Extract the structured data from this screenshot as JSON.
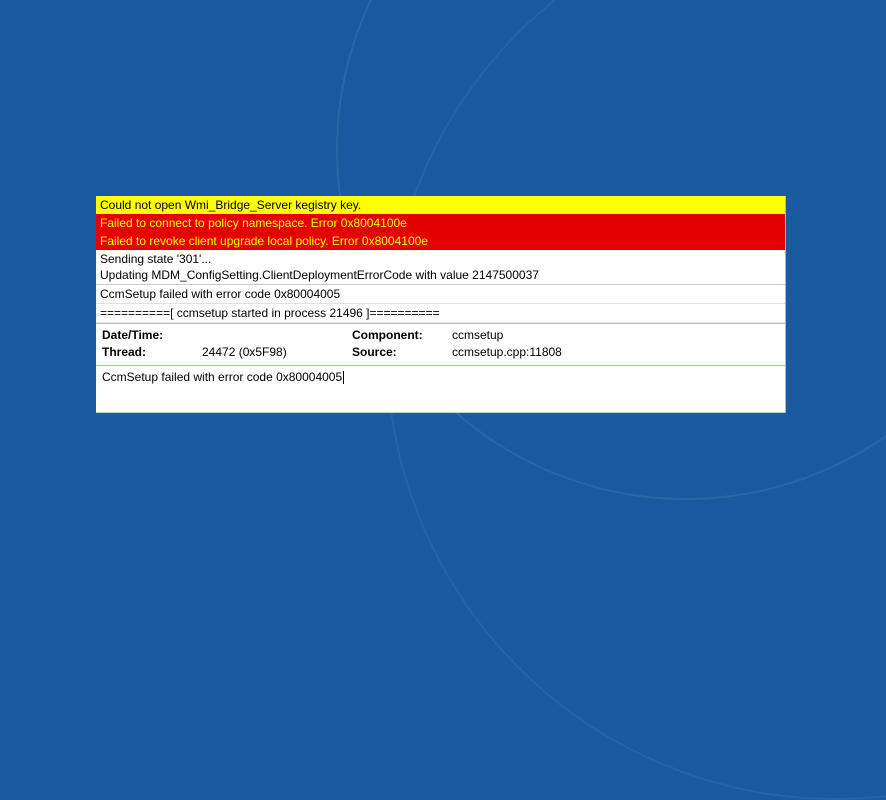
{
  "log": {
    "lines": [
      {
        "type": "yellow",
        "text": "Could not open Wmi_Bridge_Server kegistry key."
      },
      {
        "type": "red",
        "text": "Failed to connect to policy namespace. Error 0x8004100e"
      },
      {
        "type": "red",
        "text": "Failed to revoke client upgrade local policy. Error 0x8004100e"
      },
      {
        "type": "white-group",
        "lines": [
          "Sending state '301'...",
          "Updating MDM_ConfigSetting.ClientDeploymentErrorCode with value 2147500037"
        ]
      },
      {
        "type": "white",
        "text": "CcmSetup failed with error code 0x80004005"
      },
      {
        "type": "white",
        "text": "==========[ ccmsetup started in process 21496 ]=========="
      }
    ]
  },
  "details": {
    "dateTimeLabel": "Date/Time:",
    "dateTimeValue": "",
    "componentLabel": "Component:",
    "componentValue": "ccmsetup",
    "threadLabel": "Thread:",
    "threadValue": "24472 (0x5F98)",
    "sourceLabel": "Source:",
    "sourceValue": "ccmsetup.cpp:11808"
  },
  "inputArea": {
    "text": "CcmSetup failed with error code 0x80004005"
  }
}
